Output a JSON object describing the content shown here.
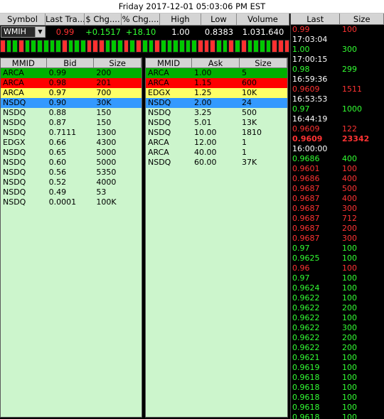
{
  "title": "Friday 2017-12-01 05:03:06 PM EST",
  "colors": {
    "green": "#00c800",
    "red": "#ff3030",
    "tape_green": "#33ff33",
    "tape_red": "#ff3333",
    "lvl1": "#00b000",
    "lvl2": "#ff0000",
    "lvl3": "#ffff66",
    "lvl4": "#3399ff",
    "book_bg": "#ccf5cc"
  },
  "summary": {
    "headers": [
      "Symbol",
      "Last Tra...",
      "$ Chg....",
      "% Chg....",
      "High",
      "Low",
      "Volume"
    ],
    "symbol": "WMIH",
    "dropdown_icon": "chevron-down-icon",
    "last": "0.99",
    "chg": "+0.1517",
    "pct": "+18.10",
    "high": "1.00",
    "low": "0.8383",
    "volume": "1.031.640"
  },
  "ticks": [
    "r",
    "g",
    "g",
    "r",
    "g",
    "g",
    "g",
    "g",
    "g",
    "g",
    "r",
    "g",
    "g",
    "g",
    "r",
    "r",
    "r",
    "g",
    "g",
    "g",
    "r",
    "g",
    "r",
    "g",
    "g",
    "r",
    "g",
    "g",
    "g",
    "g",
    "g",
    "g",
    "r",
    "r",
    "r",
    "g",
    "g",
    "r",
    "g",
    "r",
    "g",
    "g",
    "g",
    "g",
    "r",
    "r",
    "r"
  ],
  "bid_book": {
    "headers": [
      "MMID",
      "Bid",
      "Size"
    ],
    "rows": [
      {
        "mmid": "ARCA",
        "price": "0.99",
        "size": "200",
        "level": 1
      },
      {
        "mmid": "ARCA",
        "price": "0.98",
        "size": "201",
        "level": 2
      },
      {
        "mmid": "ARCA",
        "price": "0.97",
        "size": "700",
        "level": 3
      },
      {
        "mmid": "NSDQ",
        "price": "0.90",
        "size": "30K",
        "level": 4
      },
      {
        "mmid": "NSDQ",
        "price": "0.88",
        "size": "150",
        "level": 0
      },
      {
        "mmid": "NSDQ",
        "price": "0.87",
        "size": "150",
        "level": 0
      },
      {
        "mmid": "NSDQ",
        "price": "0.7111",
        "size": "1300",
        "level": 0
      },
      {
        "mmid": "EDGX",
        "price": "0.66",
        "size": "4300",
        "level": 0
      },
      {
        "mmid": "NSDQ",
        "price": "0.65",
        "size": "5000",
        "level": 0
      },
      {
        "mmid": "NSDQ",
        "price": "0.60",
        "size": "5000",
        "level": 0
      },
      {
        "mmid": "NSDQ",
        "price": "0.56",
        "size": "5350",
        "level": 0
      },
      {
        "mmid": "NSDQ",
        "price": "0.52",
        "size": "4000",
        "level": 0
      },
      {
        "mmid": "NSDQ",
        "price": "0.49",
        "size": "53",
        "level": 0
      },
      {
        "mmid": "NSDQ",
        "price": "0.0001",
        "size": "100K",
        "level": 0
      }
    ]
  },
  "ask_book": {
    "headers": [
      "MMID",
      "Ask",
      "Size"
    ],
    "rows": [
      {
        "mmid": "ARCA",
        "price": "1.00",
        "size": "5",
        "level": 1
      },
      {
        "mmid": "ARCA",
        "price": "1.15",
        "size": "600",
        "level": 2
      },
      {
        "mmid": "EDGX",
        "price": "1.25",
        "size": "10K",
        "level": 3
      },
      {
        "mmid": "NSDQ",
        "price": "2.00",
        "size": "24",
        "level": 4
      },
      {
        "mmid": "NSDQ",
        "price": "3.25",
        "size": "500",
        "level": 0
      },
      {
        "mmid": "NSDQ",
        "price": "5.01",
        "size": "13K",
        "level": 0
      },
      {
        "mmid": "NSDQ",
        "price": "10.00",
        "size": "1810",
        "level": 0
      },
      {
        "mmid": "ARCA",
        "price": "12.00",
        "size": "1",
        "level": 0
      },
      {
        "mmid": "ARCA",
        "price": "40.00",
        "size": "1",
        "level": 0
      },
      {
        "mmid": "NSDQ",
        "price": "60.00",
        "size": "37K",
        "level": 0
      }
    ]
  },
  "tape": {
    "headers": [
      "Last",
      "Size"
    ],
    "rows": [
      {
        "price": "0.99",
        "size": "100",
        "color": "red"
      },
      {
        "time": "17:03:04"
      },
      {
        "price": "1.00",
        "size": "300",
        "color": "green"
      },
      {
        "time": "17:00:15"
      },
      {
        "price": "0.98",
        "size": "299",
        "color": "green"
      },
      {
        "time": "16:59:36"
      },
      {
        "price": "0.9609",
        "size": "1511",
        "color": "red"
      },
      {
        "time": "16:53:53"
      },
      {
        "price": "0.97",
        "size": "1000",
        "color": "green"
      },
      {
        "time": "16:44:19"
      },
      {
        "price": "0.9609",
        "size": "122",
        "color": "red"
      },
      {
        "price": "0.9609",
        "size": "23342",
        "color": "red",
        "bold": true
      },
      {
        "time": "16:00:00"
      },
      {
        "price": "0.9686",
        "size": "400",
        "color": "green"
      },
      {
        "price": "0.9601",
        "size": "100",
        "color": "red"
      },
      {
        "price": "0.9686",
        "size": "400",
        "color": "red"
      },
      {
        "price": "0.9687",
        "size": "500",
        "color": "red"
      },
      {
        "price": "0.9687",
        "size": "400",
        "color": "red"
      },
      {
        "price": "0.9687",
        "size": "300",
        "color": "red"
      },
      {
        "price": "0.9687",
        "size": "712",
        "color": "red"
      },
      {
        "price": "0.9687",
        "size": "200",
        "color": "red"
      },
      {
        "price": "0.9687",
        "size": "300",
        "color": "red"
      },
      {
        "price": "0.97",
        "size": "100",
        "color": "green"
      },
      {
        "price": "0.9625",
        "size": "100",
        "color": "green"
      },
      {
        "price": "0.96",
        "size": "100",
        "color": "red"
      },
      {
        "price": "0.97",
        "size": "100",
        "color": "green"
      },
      {
        "price": "0.9624",
        "size": "100",
        "color": "green"
      },
      {
        "price": "0.9622",
        "size": "100",
        "color": "green"
      },
      {
        "price": "0.9622",
        "size": "200",
        "color": "green"
      },
      {
        "price": "0.9622",
        "size": "100",
        "color": "green"
      },
      {
        "price": "0.9622",
        "size": "300",
        "color": "green"
      },
      {
        "price": "0.9622",
        "size": "200",
        "color": "green"
      },
      {
        "price": "0.9622",
        "size": "200",
        "color": "green"
      },
      {
        "price": "0.9621",
        "size": "100",
        "color": "green"
      },
      {
        "price": "0.9619",
        "size": "100",
        "color": "green"
      },
      {
        "price": "0.9618",
        "size": "100",
        "color": "green"
      },
      {
        "price": "0.9618",
        "size": "100",
        "color": "green"
      },
      {
        "price": "0.9618",
        "size": "100",
        "color": "green"
      },
      {
        "price": "0.9618",
        "size": "100",
        "color": "green"
      },
      {
        "price": "0.9618",
        "size": "100",
        "color": "green"
      }
    ]
  }
}
